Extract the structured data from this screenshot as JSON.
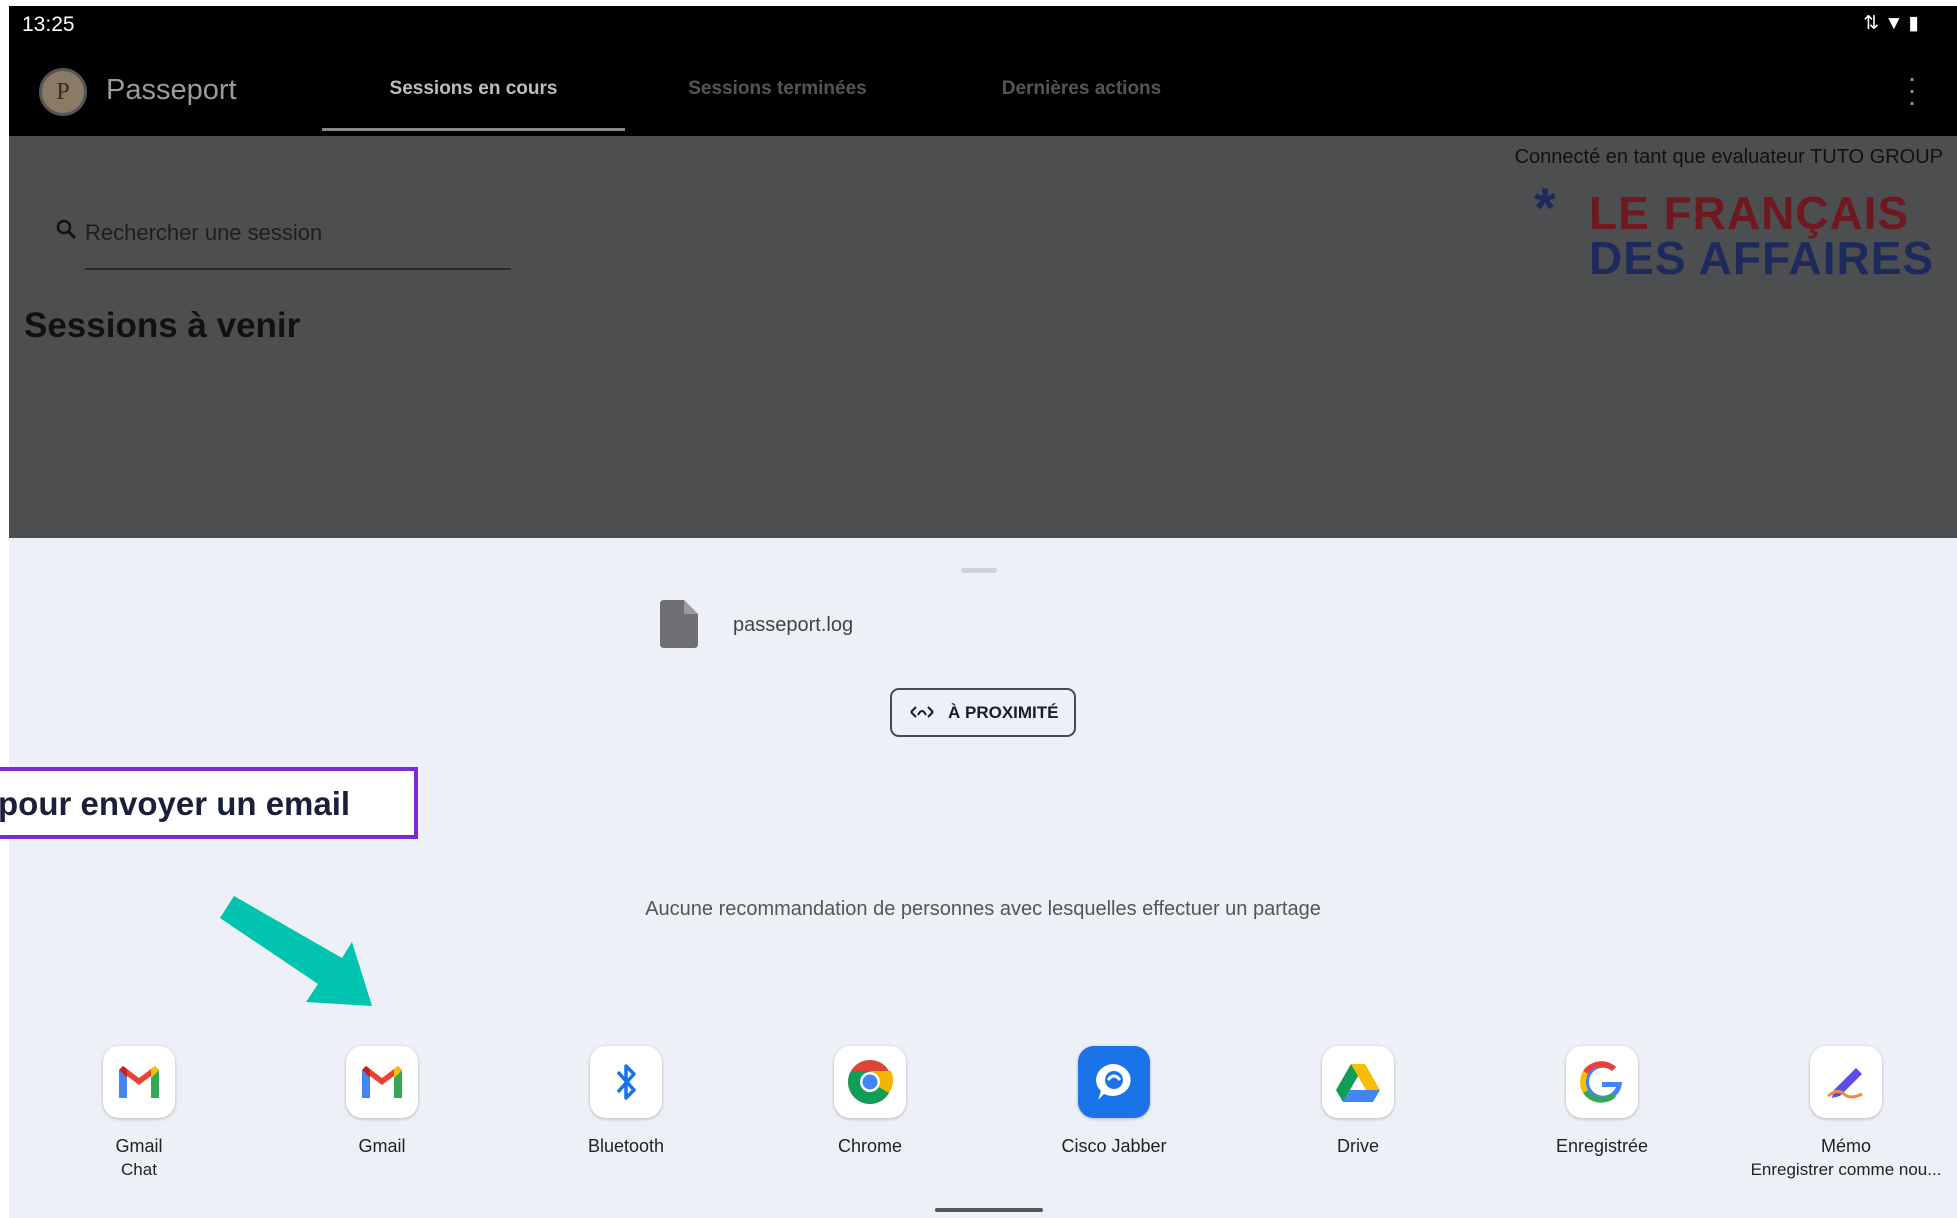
{
  "status_bar": {
    "time": "13:25",
    "icons": "⇅ ▼ ▮"
  },
  "app_bar": {
    "logo_letter": "P",
    "title": "Passeport",
    "tabs": [
      {
        "label": "Sessions en cours",
        "selected": true
      },
      {
        "label": "Sessions terminées",
        "selected": false
      },
      {
        "label": "Dernières actions",
        "selected": false
      }
    ],
    "overflow_icon": "more-vert-icon"
  },
  "content": {
    "connected_label": "Connecté en tant que evaluateur TUTO GROUP",
    "brand": {
      "star": "*",
      "line1": "LE FRANÇAIS",
      "line2": "DES AFFAIRES"
    },
    "search": {
      "placeholder": "Rechercher une session",
      "icon": "search-icon"
    },
    "section_title": "Sessions à venir"
  },
  "share_sheet": {
    "file_name": "passeport.log",
    "file_icon": "file-icon",
    "nearby_label": "À PROXIMITÉ",
    "no_recommendation": "Aucune recommandation de personnes avec lesquelles effectuer un partage",
    "apps": [
      {
        "name": "Gmail",
        "sub": "Chat",
        "icon": "gmail-icon"
      },
      {
        "name": "Gmail",
        "sub": "",
        "icon": "gmail-icon"
      },
      {
        "name": "Bluetooth",
        "sub": "",
        "icon": "bluetooth-icon"
      },
      {
        "name": "Chrome",
        "sub": "",
        "icon": "chrome-icon"
      },
      {
        "name": "Cisco Jabber",
        "sub": "",
        "icon": "cisco-jabber-icon"
      },
      {
        "name": "Drive",
        "sub": "",
        "icon": "drive-icon"
      },
      {
        "name": "Enregistrée",
        "sub": "",
        "icon": "google-icon"
      },
      {
        "name": "Mémo",
        "sub": "Enregistrer comme nou...",
        "icon": "memo-icon"
      }
    ]
  },
  "annotation": {
    "callout_text": "pour envoyer un email",
    "arrow_color": "#00c4b0",
    "box_color": "#7a2bd9"
  }
}
